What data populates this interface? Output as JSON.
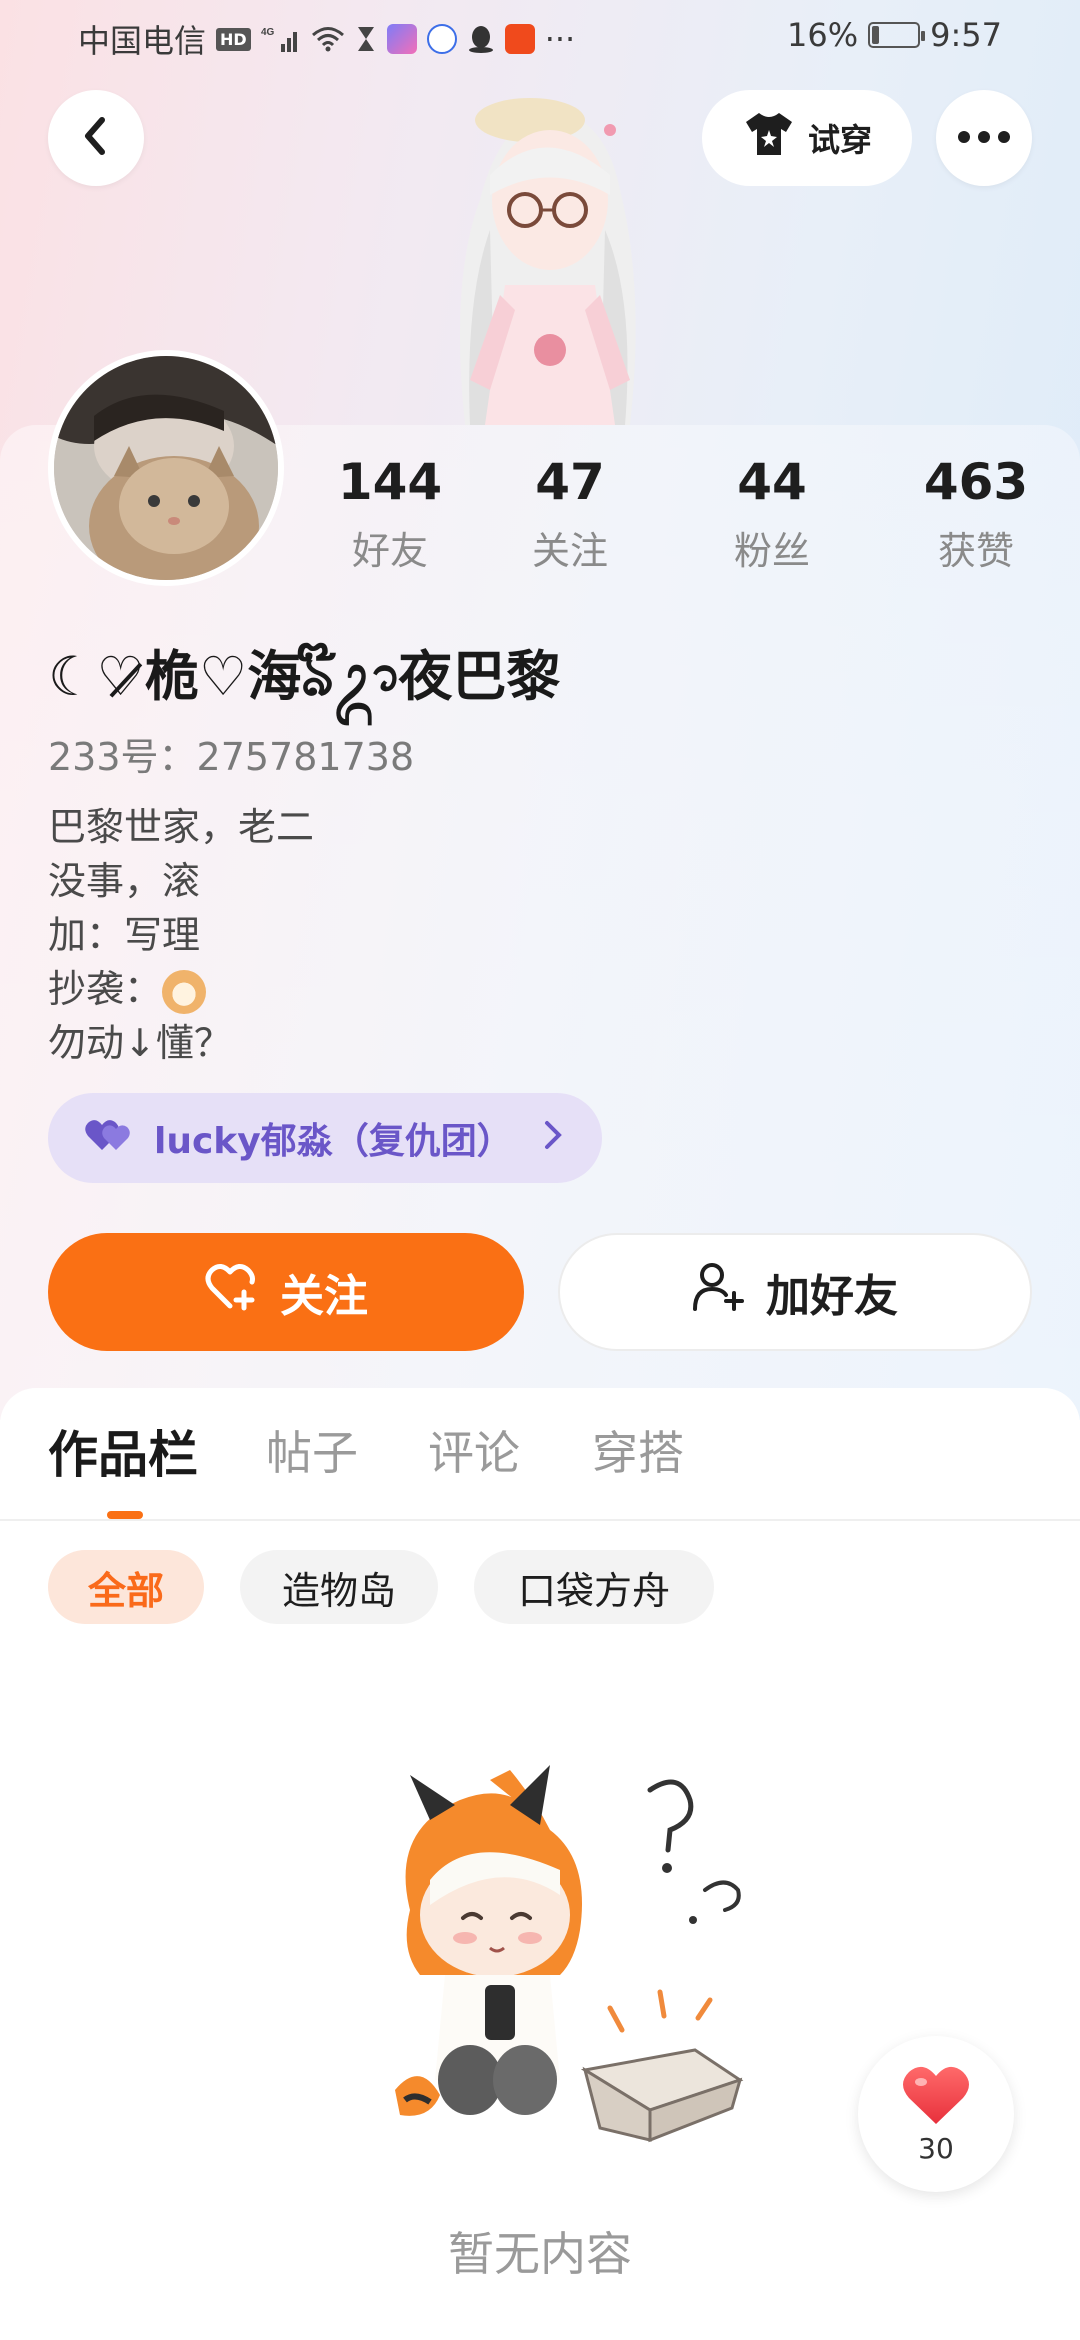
{
  "status_bar": {
    "carrier": "中国电信",
    "hd": "HD",
    "network": "4G",
    "more": "···",
    "battery_text": "16%",
    "battery_level": 0.16,
    "time": "9:57",
    "icons": [
      "signal-icon",
      "wifi-icon",
      "hourglass-icon",
      "app-icon",
      "baidu-icon",
      "qq-icon",
      "taobao-icon"
    ]
  },
  "header": {
    "back_icon": "chevron-left-icon",
    "try_on_label": "试穿",
    "try_on_icon": "tshirt-icon",
    "more_icon": "more-dots-icon"
  },
  "profile": {
    "stats": [
      {
        "value": "144",
        "label": "好友"
      },
      {
        "value": "47",
        "label": "关注"
      },
      {
        "value": "44",
        "label": "粉丝"
      },
      {
        "value": "463",
        "label": "获赞"
      }
    ],
    "nickname": "☾♡̷桅♡海ঌ໊ᬊ夜巴黎",
    "id_label": "233号：",
    "id_value": "275781738",
    "bio_lines": [
      "巴黎世家，老二",
      "没事，滚",
      "加：写理",
      "抄袭：",
      "勿动↓懂？"
    ],
    "group_name": "lucky郁淼（复仇团）",
    "follow_label": "关注",
    "add_friend_label": "加好友"
  },
  "tabs": [
    "作品栏",
    "帖子",
    "评论",
    "穿搭"
  ],
  "active_tab": 0,
  "filter_chips": [
    "全部",
    "造物岛",
    "口袋方舟"
  ],
  "active_chip": 0,
  "empty_state": {
    "text": "暂无内容"
  },
  "like_float": {
    "count": "30"
  },
  "colors": {
    "accent": "#fa7014",
    "group_text": "#6a56c8",
    "group_bg": "#e6e0f7",
    "heart": "#f0444e"
  }
}
